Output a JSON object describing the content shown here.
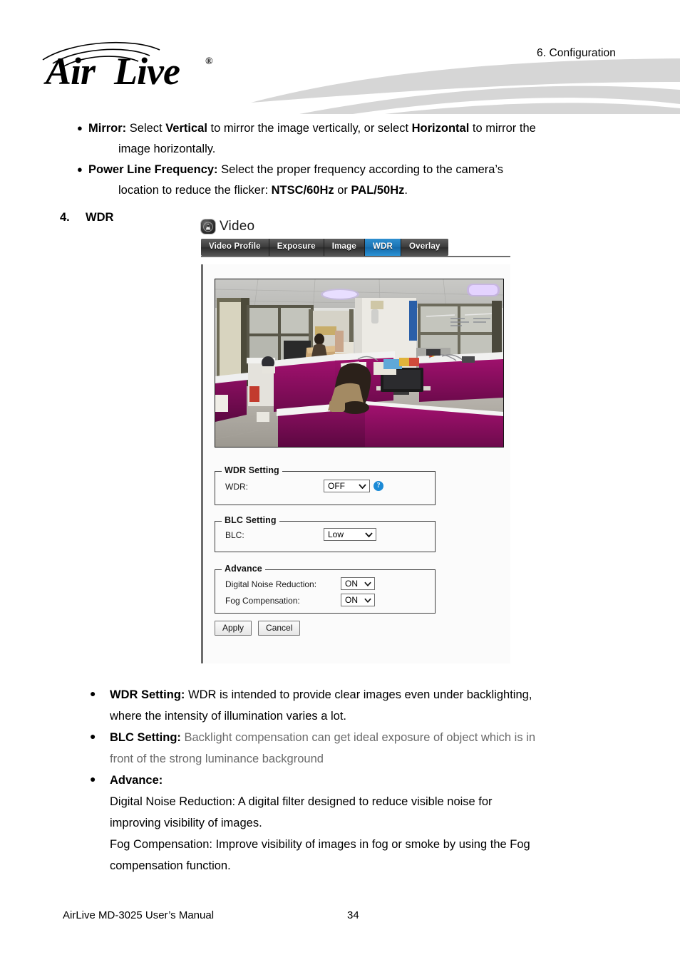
{
  "header": {
    "chapter": "6.  Configuration",
    "logo_alt": "AirLive"
  },
  "body": {
    "bullets": [
      {
        "dot": "●",
        "segments": [
          {
            "t": "Mirror:",
            "b": true
          },
          {
            "t": " Select ",
            "b": false
          },
          {
            "t": "Vertical",
            "b": true
          },
          {
            "t": " to mirror the image vertically, or select ",
            "b": false
          },
          {
            "t": "Horizontal",
            "b": true
          },
          {
            "t": " to mirror the",
            "b": false
          }
        ],
        "cont": "image horizontally."
      },
      {
        "dot": "●",
        "segments": [
          {
            "t": "Power Line Frequency:",
            "b": true
          },
          {
            "t": " Select the proper frequency according to the camera’s",
            "b": false
          }
        ],
        "cont_segments": [
          {
            "t": "location to reduce the flicker: ",
            "b": false
          },
          {
            "t": "NTSC/60Hz",
            "b": true
          },
          {
            "t": " or ",
            "b": false
          },
          {
            "t": "PAL/50Hz",
            "b": true
          },
          {
            "t": ".",
            "b": false
          }
        ]
      }
    ],
    "numbered_item": {
      "number": "4.",
      "label": "WDR"
    }
  },
  "screenshot": {
    "panel_title": "Video",
    "panel_icon": "camera-icon",
    "tabs": [
      {
        "label": "Video Profile",
        "active": false
      },
      {
        "label": "Exposure",
        "active": false
      },
      {
        "label": "Image",
        "active": false
      },
      {
        "label": "WDR",
        "active": true
      },
      {
        "label": "Overlay",
        "active": false
      }
    ],
    "active_tab_color": "#1b74b4",
    "preview": {
      "alt": "Live camera view of an office with magenta cubicle partitions"
    },
    "fieldsets": [
      {
        "legend": "WDR Setting",
        "rows": [
          {
            "label": "WDR:",
            "value": "OFF",
            "help": true,
            "help_glyph": "?"
          }
        ]
      },
      {
        "legend": "BLC Setting",
        "rows": [
          {
            "label": "BLC:",
            "value": "Low",
            "help": false
          }
        ]
      },
      {
        "legend": "Advance",
        "rows": [
          {
            "label": "Digital Noise Reduction:",
            "value": "ON",
            "help": false
          },
          {
            "label": "Fog Compensation:",
            "value": "ON",
            "help": false
          }
        ]
      }
    ],
    "buttons": [
      {
        "label": "Apply"
      },
      {
        "label": "Cancel"
      }
    ]
  },
  "lower": {
    "bullets": [
      {
        "dot": "●",
        "segments": [
          {
            "t": "WDR Setting:",
            "b": true,
            "muted": false
          },
          {
            "t": " WDR is intended to provide clear images even under backlighting,",
            "b": false,
            "muted": false
          }
        ],
        "cont": "where the intensity of illumination varies a lot.",
        "cont_muted": false
      },
      {
        "dot": "●",
        "segments": [
          {
            "t": "BLC Setting:",
            "b": true,
            "muted": false
          },
          {
            "t": " Backlight compensation can get ideal exposure of object which is in",
            "b": false,
            "muted": true
          }
        ],
        "cont": "front of the strong luminance background",
        "cont_muted": true
      },
      {
        "dot": "●",
        "segments": [
          {
            "t": "Advance:",
            "b": true,
            "muted": false
          }
        ],
        "cont": "",
        "cont_muted": false
      }
    ],
    "advance_lines": [
      "Digital Noise Reduction: A digital filter designed to reduce visible noise for",
      "improving visibility of images.",
      "Fog Compensation: Improve visibility of images in fog or smoke by using the Fog",
      "compensation function."
    ]
  },
  "footer": {
    "manual": "AirLive MD-3025 User’s Manual",
    "page": "34"
  }
}
